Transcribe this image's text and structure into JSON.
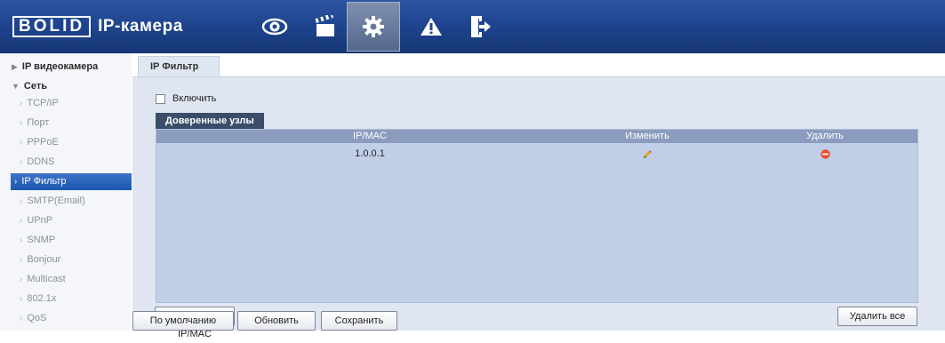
{
  "header": {
    "logo_text": "BOLID",
    "product": "IP-камера",
    "nav": [
      {
        "icon": "eye-icon"
      },
      {
        "icon": "clapperboard-icon"
      },
      {
        "icon": "gear-icon",
        "active": true
      },
      {
        "icon": "warning-icon"
      },
      {
        "icon": "logout-icon"
      }
    ]
  },
  "sidebar": {
    "sections": [
      {
        "label": "IP видеокамера",
        "state": "collapsed"
      },
      {
        "label": "Сеть",
        "state": "expanded"
      }
    ],
    "items": [
      {
        "label": "TCP/IP"
      },
      {
        "label": "Порт"
      },
      {
        "label": "PPPoE"
      },
      {
        "label": "DDNS"
      },
      {
        "label": "IP Фильтр",
        "active": true
      },
      {
        "label": "SMTP(Email)"
      },
      {
        "label": "UPnP"
      },
      {
        "label": "SNMP"
      },
      {
        "label": "Bonjour"
      },
      {
        "label": "Multicast"
      },
      {
        "label": "802.1x"
      },
      {
        "label": "QoS"
      }
    ]
  },
  "main": {
    "tab_label": "IP Фильтр",
    "enable_label": "Включить",
    "enable_checked": false,
    "trusted_label": "Доверенные узлы",
    "columns": {
      "ip": "IP/MAC",
      "edit": "Изменить",
      "delete": "Удалить"
    },
    "rows": [
      {
        "ip": "1.0.0.1"
      }
    ],
    "buttons": {
      "add": "Добавить IP/MAC",
      "delete_all": "Удалить все",
      "default": "По умолчанию",
      "refresh": "Обновить",
      "save": "Сохранить"
    }
  },
  "colors": {
    "header_bg": "#1f4590",
    "active_item": "#2a64bc",
    "panel_bg": "#dfe6f1",
    "table_bg": "#c0cfe7",
    "table_header": "#8c9cbf",
    "delete_icon": "#e8502a",
    "edit_icon": "#e6a416"
  }
}
